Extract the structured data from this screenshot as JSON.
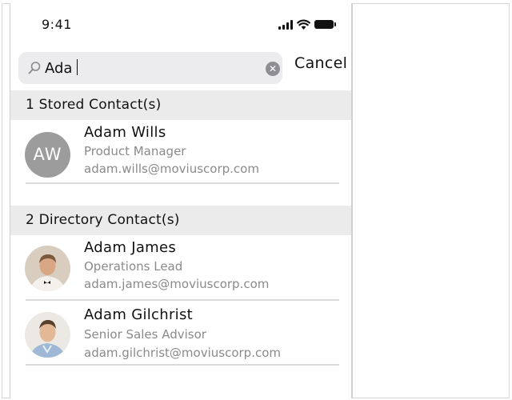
{
  "status_bar": {
    "time": "9:41"
  },
  "search": {
    "query": "Ada",
    "clear_icon": "clear-circle-icon",
    "cancel_label": "Cancel"
  },
  "sections": [
    {
      "title": "1 Stored Contact(s)"
    },
    {
      "title": "2 Directory Contact(s)"
    }
  ],
  "stored_contacts": [
    {
      "name": "Adam Wills",
      "title": "Product Manager",
      "email": "adam.wills@moviuscorp.com",
      "initials": "AW",
      "avatar_color": "#9c9c9c"
    }
  ],
  "directory_contacts": [
    {
      "name": "Adam James",
      "title": "Operations Lead",
      "email": "adam.james@moviuscorp.com",
      "avatar": "person-photo-tuxedo"
    },
    {
      "name": "Adam Gilchrist",
      "title": "Senior Sales Advisor",
      "email": "adam.gilchrist@moviuscorp.com",
      "avatar": "person-photo-shirt"
    }
  ]
}
